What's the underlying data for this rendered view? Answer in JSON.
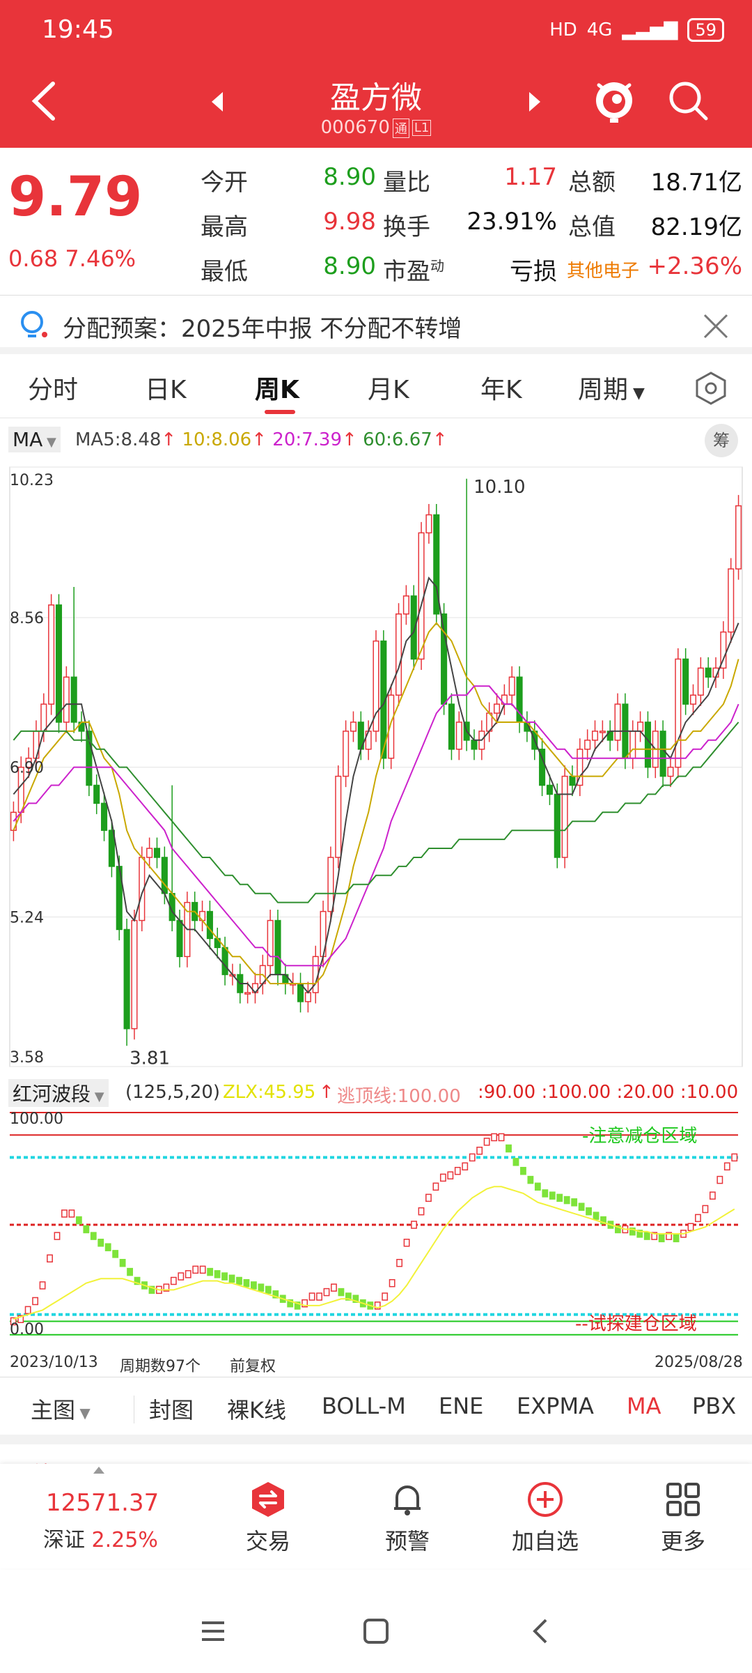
{
  "status_bar": {
    "time": "19:45",
    "network": "4G",
    "hd": "HD",
    "battery": "59"
  },
  "header": {
    "stock_name": "盈方微",
    "stock_code": "000670",
    "code_tags": [
      "通",
      "L1"
    ]
  },
  "quote": {
    "price": "9.79",
    "change": "0.68",
    "change_pct": "7.46%",
    "rows": [
      {
        "l1": "今开",
        "v1": "8.90",
        "l2": "量比",
        "v2": "1.17",
        "l3": "总额",
        "v3": "18.71亿"
      },
      {
        "l1": "最高",
        "v1": "9.98",
        "l2": "换手",
        "v2": "23.91%",
        "l3": "总值",
        "v3": "82.19亿"
      },
      {
        "l1": "最低",
        "v1": "8.90",
        "l2": "市盈",
        "l2_sup": "动",
        "v2": "亏损",
        "l3": "其他电子",
        "v3": "+2.36%"
      }
    ]
  },
  "notice": {
    "text": "分配预案：2025年中报 不分配不转增"
  },
  "tabs": [
    "分时",
    "日K",
    "周K",
    "月K",
    "年K",
    "周期"
  ],
  "active_tab": "周K",
  "ma_bar": {
    "select": "MA",
    "ma5": "MA5:8.48",
    "ma10": "10:8.06",
    "ma20": "20:7.39",
    "ma60": "60:6.67",
    "chip_label": "筹"
  },
  "colors": {
    "up": "#e8343a",
    "down": "#1d9e1d",
    "ma5": "#444444",
    "ma10": "#c9a800",
    "ma20": "#cc22cc",
    "ma60": "#2f8f2f"
  },
  "chart_data": {
    "type": "candlestick",
    "period": "weekly",
    "y_ticks": [
      "10.23",
      "8.56",
      "6.90",
      "5.24",
      "3.58"
    ],
    "ylim": [
      3.58,
      10.23
    ],
    "annotations": {
      "high": "10.10",
      "low": "3.81"
    },
    "closes": [
      6.4,
      6.9,
      7.0,
      7.3,
      7.6,
      8.7,
      7.4,
      7.9,
      7.4,
      7.3,
      6.7,
      6.5,
      6.2,
      5.8,
      5.1,
      4.0,
      5.2,
      5.9,
      6.0,
      5.9,
      5.5,
      5.2,
      4.8,
      5.4,
      5.2,
      5.3,
      5.0,
      4.9,
      4.6,
      4.6,
      4.4,
      4.4,
      4.5,
      4.7,
      5.2,
      4.6,
      4.5,
      4.5,
      4.3,
      4.4,
      4.8,
      5.3,
      5.9,
      6.8,
      7.3,
      7.4,
      7.1,
      7.3,
      8.3,
      7.0,
      7.7,
      8.6,
      8.8,
      8.1,
      9.5,
      9.7,
      8.6,
      7.6,
      7.1,
      7.4,
      7.2,
      7.1,
      7.3,
      7.5,
      7.6,
      7.7,
      7.9,
      7.4,
      7.3,
      7.1,
      6.7,
      6.6,
      5.9,
      6.8,
      6.7,
      7.1,
      7.2,
      7.3,
      7.3,
      7.2,
      7.6,
      7.0,
      7.3,
      7.4,
      6.9,
      7.3,
      6.8,
      6.9,
      8.1,
      7.6,
      7.7,
      8.0,
      7.9,
      8.0,
      8.4,
      9.1,
      9.8
    ],
    "highs_extra": {
      "8": 8.9,
      "21": 6.7,
      "60": 10.1,
      "15": 3.81
    },
    "ma5": [
      6.6,
      6.7,
      6.8,
      7.0,
      7.3,
      7.4,
      7.5,
      7.6,
      7.6,
      7.6,
      7.2,
      6.9,
      6.6,
      6.3,
      5.8,
      5.3,
      5.2,
      5.5,
      5.7,
      5.6,
      5.5,
      5.3,
      5.2,
      5.1,
      5.1,
      5.0,
      4.9,
      4.8,
      4.7,
      4.6,
      4.5,
      4.5,
      4.4,
      4.5,
      4.6,
      4.6,
      4.6,
      4.5,
      4.5,
      4.4,
      4.5,
      4.8,
      5.2,
      5.7,
      6.3,
      6.8,
      7.1,
      7.3,
      7.5,
      7.6,
      7.8,
      8.0,
      8.3,
      8.4,
      8.7,
      9.0,
      8.9,
      8.4,
      8.0,
      7.6,
      7.3,
      7.2,
      7.2,
      7.3,
      7.4,
      7.6,
      7.6,
      7.5,
      7.4,
      7.2,
      7.0,
      6.8,
      6.6,
      6.6,
      6.6,
      6.8,
      6.9,
      7.1,
      7.2,
      7.3,
      7.3,
      7.3,
      7.3,
      7.3,
      7.2,
      7.1,
      7.1,
      7.0,
      7.2,
      7.4,
      7.5,
      7.6,
      7.7,
      7.9,
      8.1,
      8.3,
      8.5
    ],
    "ma10": [
      6.2,
      6.4,
      6.6,
      6.8,
      7.0,
      7.1,
      7.2,
      7.3,
      7.3,
      7.4,
      7.4,
      7.2,
      7.0,
      6.9,
      6.6,
      6.2,
      6.0,
      5.9,
      5.8,
      5.7,
      5.6,
      5.5,
      5.4,
      5.3,
      5.3,
      5.2,
      5.1,
      5.0,
      4.9,
      4.8,
      4.8,
      4.7,
      4.6,
      4.6,
      4.5,
      4.5,
      4.5,
      4.5,
      4.5,
      4.5,
      4.5,
      4.6,
      4.8,
      5.1,
      5.4,
      5.8,
      6.1,
      6.4,
      6.8,
      7.1,
      7.4,
      7.6,
      7.8,
      8.0,
      8.2,
      8.4,
      8.5,
      8.4,
      8.3,
      8.1,
      7.9,
      7.8,
      7.6,
      7.5,
      7.4,
      7.4,
      7.4,
      7.4,
      7.4,
      7.3,
      7.2,
      7.1,
      7.0,
      6.9,
      6.8,
      6.8,
      6.8,
      6.8,
      6.8,
      6.9,
      7.0,
      7.0,
      7.1,
      7.1,
      7.1,
      7.1,
      7.1,
      7.1,
      7.2,
      7.2,
      7.3,
      7.3,
      7.4,
      7.5,
      7.6,
      7.8,
      8.1
    ],
    "ma20": [
      6.3,
      6.4,
      6.5,
      6.5,
      6.6,
      6.7,
      6.7,
      6.8,
      6.9,
      6.9,
      6.9,
      6.9,
      6.9,
      6.9,
      6.8,
      6.7,
      6.6,
      6.5,
      6.4,
      6.3,
      6.2,
      6.0,
      5.9,
      5.8,
      5.7,
      5.6,
      5.5,
      5.4,
      5.3,
      5.2,
      5.1,
      5.0,
      4.9,
      4.9,
      4.8,
      4.8,
      4.7,
      4.7,
      4.7,
      4.7,
      4.7,
      4.7,
      4.8,
      4.9,
      5.0,
      5.2,
      5.4,
      5.6,
      5.8,
      6.0,
      6.3,
      6.5,
      6.7,
      6.9,
      7.1,
      7.3,
      7.5,
      7.6,
      7.7,
      7.7,
      7.7,
      7.8,
      7.8,
      7.8,
      7.7,
      7.6,
      7.6,
      7.5,
      7.4,
      7.4,
      7.3,
      7.2,
      7.1,
      7.1,
      7.0,
      7.0,
      7.0,
      7.0,
      7.0,
      7.0,
      7.0,
      7.0,
      7.0,
      7.0,
      7.0,
      7.0,
      7.0,
      7.0,
      7.0,
      7.0,
      7.1,
      7.1,
      7.2,
      7.2,
      7.3,
      7.4,
      7.6
    ],
    "ma60": [
      7.2,
      7.3,
      7.3,
      7.3,
      7.3,
      7.3,
      7.3,
      7.3,
      7.2,
      7.2,
      7.2,
      7.1,
      7.1,
      7.0,
      6.9,
      6.9,
      6.8,
      6.7,
      6.6,
      6.5,
      6.4,
      6.3,
      6.2,
      6.1,
      6.0,
      5.9,
      5.9,
      5.8,
      5.7,
      5.7,
      5.6,
      5.6,
      5.5,
      5.5,
      5.5,
      5.4,
      5.4,
      5.4,
      5.4,
      5.4,
      5.5,
      5.5,
      5.5,
      5.5,
      5.5,
      5.6,
      5.6,
      5.6,
      5.7,
      5.7,
      5.7,
      5.8,
      5.8,
      5.9,
      5.9,
      6.0,
      6.0,
      6.0,
      6.0,
      6.1,
      6.1,
      6.1,
      6.1,
      6.1,
      6.1,
      6.1,
      6.2,
      6.2,
      6.2,
      6.2,
      6.2,
      6.2,
      6.2,
      6.2,
      6.3,
      6.3,
      6.3,
      6.3,
      6.4,
      6.4,
      6.4,
      6.5,
      6.5,
      6.5,
      6.6,
      6.6,
      6.7,
      6.7,
      6.8,
      6.8,
      6.9,
      6.9,
      7.0,
      7.1,
      7.2,
      7.3,
      7.4
    ]
  },
  "indicator": {
    "name": "红河波段",
    "params": "(125,5,20)",
    "zlx": "ZLX:45.95",
    "escape_label": "逃顶线:100.00",
    "levels_text": ":90.00 :100.00 :20.00 :10.00",
    "y_top": "100.00",
    "y_bottom": "0.00",
    "top_zone_label": "-注意减仓区域",
    "bottom_zone_label": "--试探建仓区域",
    "levels": [
      100,
      90,
      80,
      50,
      10,
      7
    ],
    "values": [
      7,
      8,
      12,
      16,
      23,
      35,
      45,
      55,
      55,
      52,
      48,
      45,
      42,
      40,
      37,
      33,
      29,
      25,
      23,
      21,
      21,
      22,
      25,
      27,
      28,
      30,
      30,
      29,
      28,
      27,
      26,
      25,
      24,
      23,
      22,
      21,
      19,
      17,
      15,
      14,
      15,
      18,
      18,
      20,
      22,
      20,
      18,
      17,
      15,
      14,
      14,
      18,
      24,
      33,
      42,
      50,
      56,
      62,
      67,
      71,
      72,
      74,
      76,
      80,
      83,
      87,
      89,
      89,
      84,
      78,
      74,
      70,
      67,
      64,
      63,
      62,
      61,
      60,
      58,
      56,
      54,
      52,
      50,
      48,
      48,
      47,
      46,
      45,
      45,
      44,
      45,
      44,
      46,
      49,
      53,
      57,
      63,
      70,
      76,
      80
    ],
    "signal": [
      8,
      9,
      10,
      11,
      12,
      14,
      16,
      18,
      20,
      22,
      24,
      25,
      26,
      26,
      26,
      26,
      25,
      24,
      23,
      22,
      21,
      21,
      21,
      22,
      23,
      24,
      25,
      25,
      25,
      24,
      24,
      23,
      22,
      21,
      20,
      19,
      18,
      17,
      16,
      15,
      14,
      14,
      14,
      15,
      16,
      17,
      17,
      16,
      15,
      14,
      13,
      14,
      16,
      19,
      23,
      28,
      33,
      38,
      43,
      48,
      52,
      56,
      59,
      62,
      64,
      66,
      67,
      67,
      66,
      65,
      64,
      62,
      60,
      59,
      58,
      57,
      56,
      55,
      54,
      53,
      52,
      51,
      50,
      49,
      48,
      48,
      47,
      47,
      46,
      46,
      46,
      46,
      46,
      47,
      48,
      49,
      51,
      53,
      55,
      57
    ]
  },
  "date_row": {
    "start": "2023/10/13",
    "count": "周期数97个",
    "adjust": "前复权",
    "end": "2025/08/28"
  },
  "ind_bar": [
    "主图",
    "封图",
    "裸K线",
    "BOLL-M",
    "ENE",
    "EXPMA",
    "MA",
    "PBX"
  ],
  "active_ind": "MA",
  "peek_text": "综评",
  "bottom_nav": {
    "index_value": "12571.37",
    "index_name": "深证",
    "index_pct": "2.25%",
    "items": [
      "交易",
      "预警",
      "加自选",
      "更多"
    ]
  }
}
